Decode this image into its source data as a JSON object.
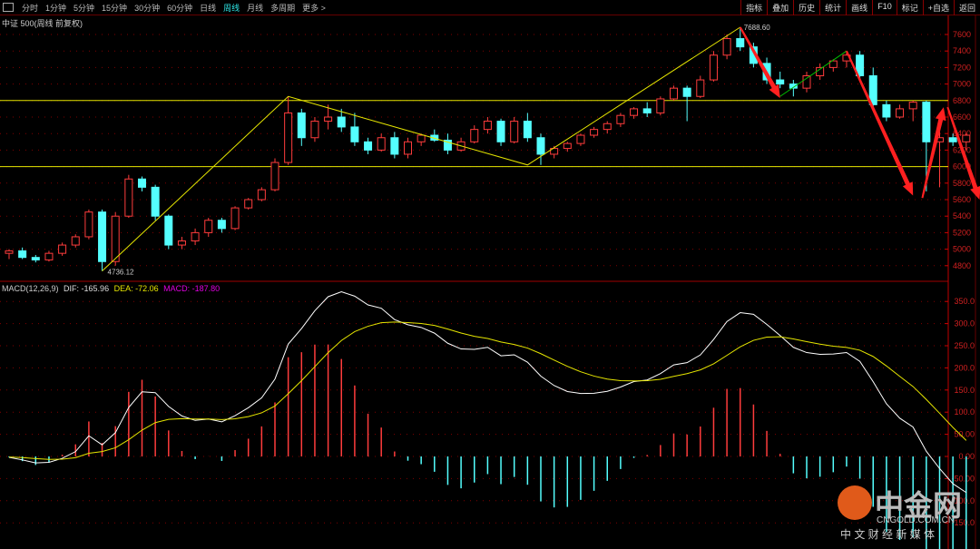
{
  "toolbar": {
    "periods": [
      "分时",
      "1分钟",
      "5分钟",
      "15分钟",
      "30分钟",
      "60分钟",
      "日线",
      "周线",
      "月线",
      "多周期",
      "更多 >"
    ],
    "active": "周线",
    "right": [
      "指标",
      "叠加",
      "历史",
      "统计",
      "画线",
      "F10",
      "标记",
      "+自选",
      "返回"
    ]
  },
  "info": {
    "title": "中证 500(周线 前复权)"
  },
  "macd": {
    "label": "MACD(12,26,9)",
    "dif": "DIF: -165.96",
    "dea": "DEA: -72.06",
    "macd": "MACD: -187.80"
  },
  "watermark": {
    "name": "中金网",
    "url": "CNGOLD.COM.CN",
    "tagline": "中 文 财 经 新 媒 体"
  },
  "colors": {
    "up": "#ff3c3c",
    "down": "#54ffff",
    "dif": "#ffffff",
    "dea": "#e6e600",
    "grid": "#800000",
    "hline": "#e6e600",
    "arrow": "#ff2020"
  },
  "chart_data": [
    {
      "type": "candlestick",
      "title": "中证 500(周线 前复权)",
      "ylim": [
        4650,
        7750
      ],
      "yticks": [
        4800,
        5000,
        5200,
        5400,
        5600,
        5800,
        6000,
        6200,
        6400,
        6600,
        6800,
        7000,
        7200,
        7400,
        7600
      ],
      "annotations": [
        {
          "text": "4736.12",
          "price": 4736.12
        },
        {
          "text": "7688.60",
          "price": 7688.6
        }
      ],
      "hlines": [
        6800,
        6000
      ],
      "ohlc": [
        [
          4950,
          5000,
          4880,
          4980
        ],
        [
          4980,
          5020,
          4880,
          4900
        ],
        [
          4900,
          4930,
          4840,
          4870
        ],
        [
          4870,
          4980,
          4850,
          4950
        ],
        [
          4950,
          5080,
          4920,
          5050
        ],
        [
          5050,
          5180,
          5020,
          5150
        ],
        [
          5150,
          5480,
          5120,
          5450
        ],
        [
          5450,
          5480,
          4736,
          4850
        ],
        [
          4850,
          5450,
          4800,
          5400
        ],
        [
          5400,
          5900,
          5380,
          5850
        ],
        [
          5850,
          5880,
          5700,
          5750
        ],
        [
          5750,
          5780,
          5350,
          5400
        ],
        [
          5400,
          5420,
          5000,
          5050
        ],
        [
          5050,
          5150,
          5000,
          5100
        ],
        [
          5100,
          5250,
          5050,
          5200
        ],
        [
          5200,
          5380,
          5150,
          5350
        ],
        [
          5350,
          5380,
          5200,
          5250
        ],
        [
          5250,
          5520,
          5230,
          5500
        ],
        [
          5500,
          5620,
          5480,
          5600
        ],
        [
          5600,
          5750,
          5580,
          5720
        ],
        [
          5720,
          6100,
          5700,
          6050
        ],
        [
          6050,
          6850,
          6020,
          6650
        ],
        [
          6650,
          6700,
          6250,
          6350
        ],
        [
          6350,
          6600,
          6300,
          6550
        ],
        [
          6550,
          6750,
          6450,
          6600
        ],
        [
          6600,
          6700,
          6420,
          6480
        ],
        [
          6480,
          6650,
          6250,
          6300
        ],
        [
          6300,
          6350,
          6150,
          6200
        ],
        [
          6200,
          6400,
          6180,
          6350
        ],
        [
          6350,
          6420,
          6100,
          6150
        ],
        [
          6150,
          6350,
          6100,
          6300
        ],
        [
          6300,
          6400,
          6250,
          6380
        ],
        [
          6380,
          6450,
          6300,
          6320
        ],
        [
          6320,
          6400,
          6150,
          6200
        ],
        [
          6200,
          6350,
          6180,
          6300
        ],
        [
          6300,
          6500,
          6280,
          6450
        ],
        [
          6450,
          6600,
          6400,
          6550
        ],
        [
          6550,
          6580,
          6250,
          6300
        ],
        [
          6300,
          6600,
          6280,
          6550
        ],
        [
          6550,
          6650,
          6300,
          6350
        ],
        [
          6350,
          6400,
          6020,
          6150
        ],
        [
          6150,
          6250,
          6100,
          6220
        ],
        [
          6220,
          6300,
          6180,
          6280
        ],
        [
          6280,
          6400,
          6250,
          6380
        ],
        [
          6380,
          6480,
          6350,
          6450
        ],
        [
          6450,
          6550,
          6400,
          6520
        ],
        [
          6520,
          6650,
          6480,
          6620
        ],
        [
          6620,
          6720,
          6580,
          6700
        ],
        [
          6700,
          6780,
          6600,
          6650
        ],
        [
          6650,
          6850,
          6620,
          6820
        ],
        [
          6820,
          6980,
          6800,
          6950
        ],
        [
          6950,
          6980,
          6550,
          6850
        ],
        [
          6850,
          7100,
          6830,
          7050
        ],
        [
          7050,
          7400,
          7030,
          7350
        ],
        [
          7350,
          7600,
          7300,
          7550
        ],
        [
          7550,
          7688.6,
          7400,
          7450
        ],
        [
          7450,
          7500,
          7200,
          7250
        ],
        [
          7250,
          7320,
          7000,
          7050
        ],
        [
          7050,
          7150,
          6950,
          7000
        ],
        [
          7000,
          7050,
          6850,
          6950
        ],
        [
          6950,
          7150,
          6900,
          7100
        ],
        [
          7100,
          7250,
          7050,
          7200
        ],
        [
          7200,
          7300,
          7150,
          7280
        ],
        [
          7280,
          7400,
          7200,
          7350
        ],
        [
          7350,
          7400,
          7050,
          7100
        ],
        [
          7100,
          7200,
          6700,
          6750
        ],
        [
          6750,
          6800,
          6550,
          6600
        ],
        [
          6600,
          6750,
          6580,
          6700
        ],
        [
          6700,
          6800,
          6550,
          6780
        ],
        [
          6780,
          6800,
          5700,
          6300
        ],
        [
          6300,
          6450,
          5750,
          6350
        ],
        [
          6350,
          6400,
          6250,
          6300
        ],
        [
          6300,
          6400,
          6200,
          6380
        ]
      ],
      "trendlines": [
        {
          "color": "#e6e600",
          "points": [
            [
              7,
              4736
            ],
            [
              21,
              6850
            ],
            [
              39,
              6020
            ],
            [
              55,
              7688
            ]
          ]
        },
        {
          "color": "#00c000",
          "points": [
            [
              58,
              6850
            ],
            [
              63,
              7400
            ]
          ]
        }
      ],
      "arrows": [
        {
          "from": [
            55,
            7688
          ],
          "to": [
            58,
            6830
          ]
        },
        {
          "from": [
            63,
            7400
          ],
          "to": [
            68,
            5650
          ]
        },
        {
          "from": [
            68.7,
            5620
          ],
          "to": [
            70.3,
            6720
          ]
        },
        {
          "from": [
            70.6,
            6720
          ],
          "to": [
            73,
            5600
          ]
        }
      ]
    },
    {
      "type": "macd",
      "ylim": [
        -170,
        380
      ],
      "yticks": [
        350,
        300,
        250,
        200,
        150,
        100,
        50,
        0,
        -50,
        -100,
        -150
      ],
      "ytick_labels": [
        "350.0",
        "300.0",
        "250.0",
        "200.0",
        "150.0",
        "100.0",
        "50.00",
        "0.00",
        "-50.00",
        "-100.0",
        "-150.0"
      ]
    }
  ]
}
